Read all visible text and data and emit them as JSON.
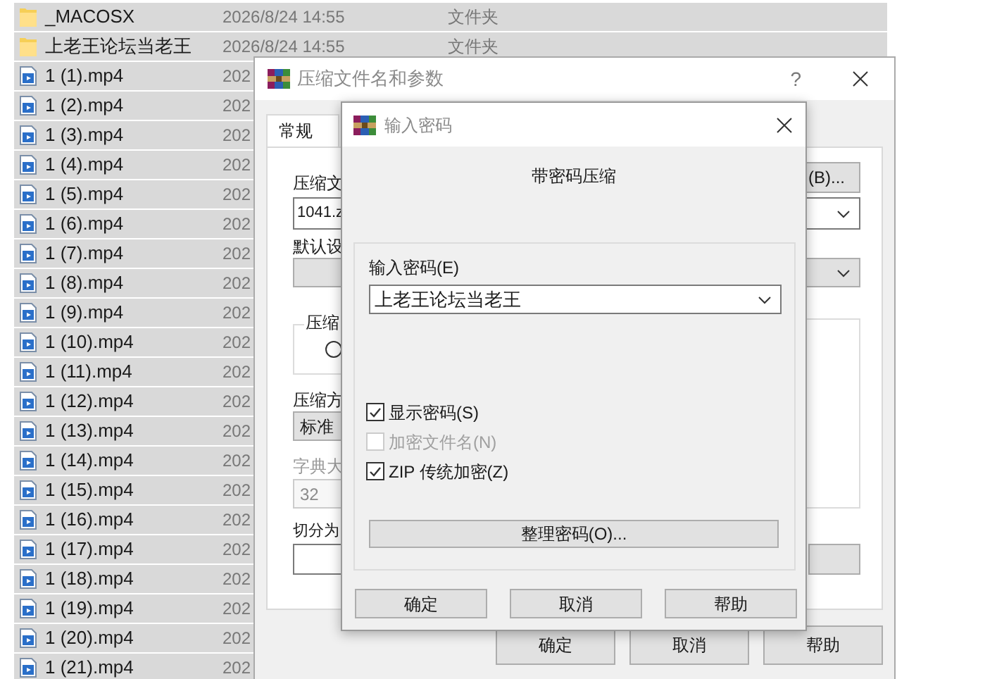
{
  "file_list": {
    "rows": [
      {
        "kind": "folder",
        "name": "_MACOSX",
        "modified": "2026/8/24 14:55",
        "type": "文件夹",
        "selected": true
      },
      {
        "kind": "folder",
        "name": "上老王论坛当老王",
        "modified": "2026/8/24 14:55",
        "type": "文件夹",
        "selected": true
      },
      {
        "kind": "video",
        "name": "1 (1).mp4",
        "modified": "202",
        "selected": true
      },
      {
        "kind": "video",
        "name": "1 (2).mp4",
        "modified": "202",
        "selected": true
      },
      {
        "kind": "video",
        "name": "1 (3).mp4",
        "modified": "202",
        "selected": true
      },
      {
        "kind": "video",
        "name": "1 (4).mp4",
        "modified": "202",
        "selected": true
      },
      {
        "kind": "video",
        "name": "1 (5).mp4",
        "modified": "202",
        "selected": true
      },
      {
        "kind": "video",
        "name": "1 (6).mp4",
        "modified": "202",
        "selected": true
      },
      {
        "kind": "video",
        "name": "1 (7).mp4",
        "modified": "202",
        "selected": true
      },
      {
        "kind": "video",
        "name": "1 (8).mp4",
        "modified": "202",
        "selected": true
      },
      {
        "kind": "video",
        "name": "1 (9).mp4",
        "modified": "202",
        "selected": true
      },
      {
        "kind": "video",
        "name": "1 (10).mp4",
        "modified": "202",
        "selected": true
      },
      {
        "kind": "video",
        "name": "1 (11).mp4",
        "modified": "202",
        "selected": true
      },
      {
        "kind": "video",
        "name": "1 (12).mp4",
        "modified": "202",
        "selected": true
      },
      {
        "kind": "video",
        "name": "1 (13).mp4",
        "modified": "202",
        "selected": true
      },
      {
        "kind": "video",
        "name": "1 (14).mp4",
        "modified": "202",
        "selected": true
      },
      {
        "kind": "video",
        "name": "1 (15).mp4",
        "modified": "202",
        "selected": true
      },
      {
        "kind": "video",
        "name": "1 (16).mp4",
        "modified": "202",
        "selected": true
      },
      {
        "kind": "video",
        "name": "1 (17).mp4",
        "modified": "202",
        "selected": true
      },
      {
        "kind": "video",
        "name": "1 (18).mp4",
        "modified": "202",
        "selected": true
      },
      {
        "kind": "video",
        "name": "1 (19).mp4",
        "modified": "202",
        "selected": true
      },
      {
        "kind": "video",
        "name": "1 (20).mp4",
        "modified": "202",
        "selected": true
      },
      {
        "kind": "video",
        "name": "1 (21).mp4",
        "modified": "202",
        "selected": true
      }
    ]
  },
  "archive_dialog": {
    "title": "压缩文件名和参数",
    "help": "?",
    "tabs": [
      {
        "label": "常规",
        "selected": true
      }
    ],
    "archive_name_label": "压缩文",
    "browse_button": "(B)...",
    "archive_name_value": "1041.z",
    "profile_label": "默认设",
    "format_group_label": "压缩",
    "format_radio": {
      "selected": false
    },
    "method_label": "压缩方",
    "method_value": "标准",
    "dictionary_label": "字典大",
    "dictionary_value": "32",
    "split_label": "切分为",
    "buttons": [
      "确定",
      "取消",
      "帮助"
    ]
  },
  "password_dialog": {
    "title": "输入密码",
    "heading": "带密码压缩",
    "password_label": "输入密码(E)",
    "password_value": "上老王论坛当老王",
    "options": [
      {
        "label": "显示密码(S)",
        "checked": true,
        "disabled": false
      },
      {
        "label": "加密文件名(N)",
        "checked": false,
        "disabled": true
      },
      {
        "label": "ZIP 传统加密(Z)",
        "checked": true,
        "disabled": false
      }
    ],
    "manage_button": "整理密码(O)...",
    "buttons": [
      "确定",
      "取消",
      "帮助"
    ]
  }
}
